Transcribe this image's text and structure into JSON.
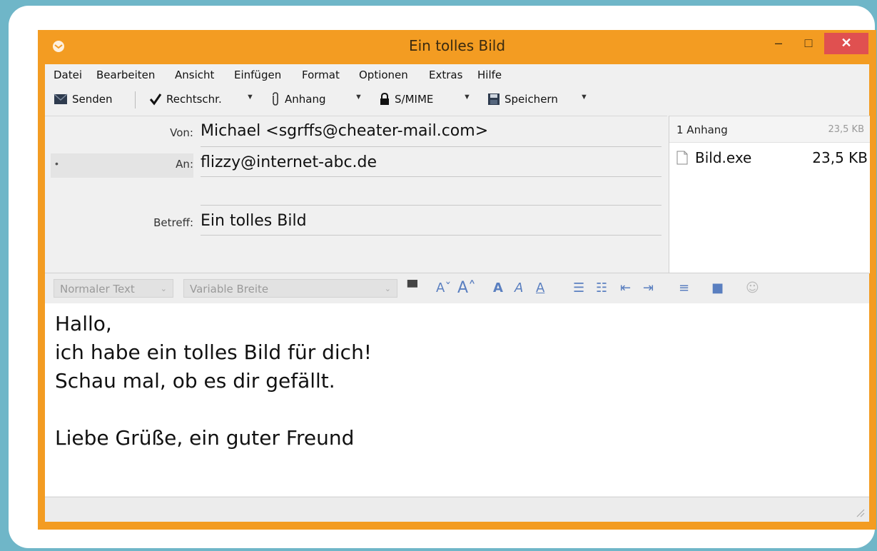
{
  "window": {
    "title": "Ein tolles Bild",
    "minimize_label": "–",
    "maximize_label": "□",
    "close_label": "✕"
  },
  "menu": [
    "Datei",
    "Bearbeiten",
    "Ansicht",
    "Einfügen",
    "Format",
    "Optionen",
    "Extras",
    "Hilfe"
  ],
  "toolbar": {
    "send_label": "Senden",
    "spell_label": "Rechtschr.",
    "attach_label": "Anhang",
    "smime_label": "S/MIME",
    "save_label": "Speichern",
    "dropdown_glyph": "▼"
  },
  "headers": {
    "from_label": "Von:",
    "from_value": "Michael <sgrffs@cheater-mail.com>",
    "to_label": "An:",
    "to_value": "flizzy@internet-abc.de",
    "to_marker": "•",
    "subject_label": "Betreff:",
    "subject_value": "Ein tolles Bild"
  },
  "attachments": {
    "count_label": "1 Anhang",
    "total_size": "23,5 KB",
    "files": [
      {
        "name": "Bild.exe",
        "size": "23,5 KB"
      }
    ]
  },
  "format_toolbar": {
    "paragraph_style": "Normaler Text",
    "font": "Variable Breite",
    "arrow": "⌄"
  },
  "body": {
    "lines": [
      "Hallo,",
      "ich habe ein tolles Bild für dich!",
      "Schau mal, ob es dir gefällt.",
      "Liebe Grüße, ein guter Freund"
    ]
  },
  "colors": {
    "window_frame": "#f39c22",
    "close_button": "#e05050",
    "background": "#6fb6c8"
  }
}
